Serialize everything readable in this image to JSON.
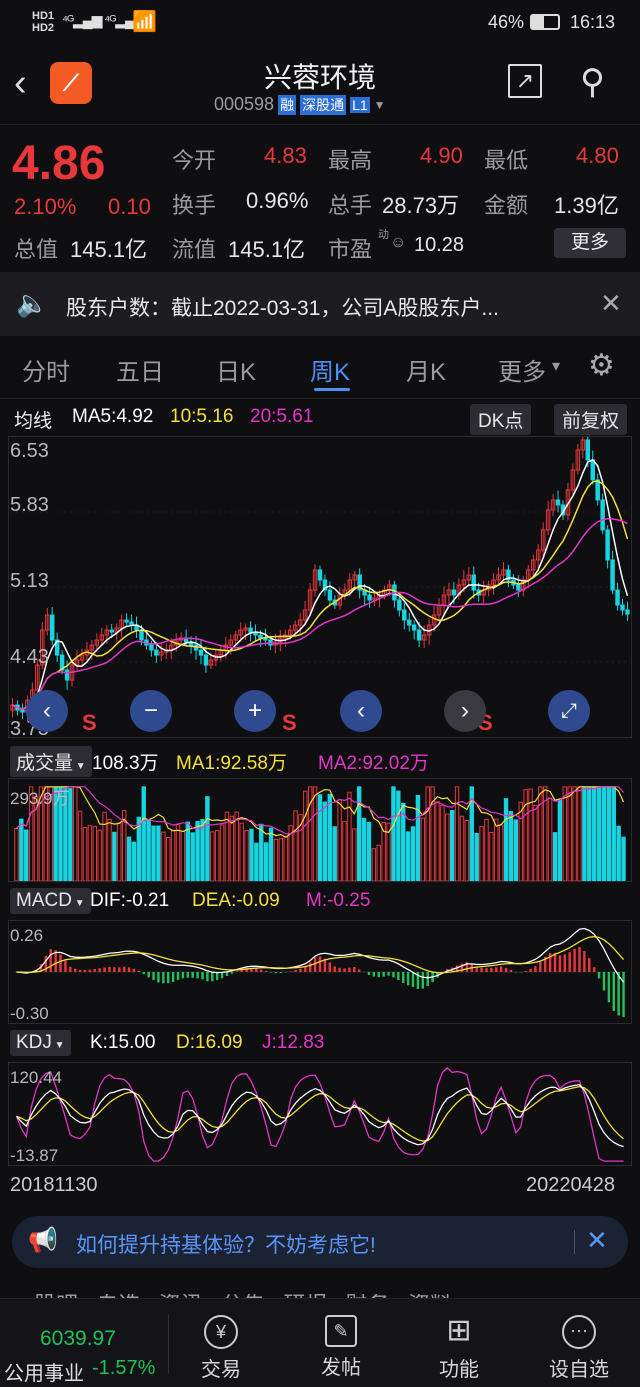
{
  "status": {
    "left_icons": "HD1 HD2 4G 4G wifi",
    "battery": "46%",
    "time": "16:13"
  },
  "header": {
    "title": "兴蓉环境",
    "code": "000598",
    "badge_margin": "融",
    "badge_connect": "深股通",
    "badge_level": "L1"
  },
  "quote": {
    "price": "4.86",
    "change_pct": "2.10%",
    "change_amt": "0.10",
    "open_label": "今开",
    "open": "4.83",
    "high_label": "最高",
    "high": "4.90",
    "low_label": "最低",
    "low": "4.80",
    "turnover_label": "换手",
    "turnover": "0.96%",
    "volume_label": "总手",
    "volume": "28.73万",
    "amount_label": "金额",
    "amount": "1.39亿",
    "mktcap_label": "总值",
    "mktcap": "145.1亿",
    "float_label": "流值",
    "float": "145.1亿",
    "pe_label": "市盈",
    "pe_sup": "动",
    "pe": "10.28",
    "more_button": "更多"
  },
  "notice": {
    "text": "股东户数：截止2022-03-31，公司A股股东户..."
  },
  "tabs": [
    {
      "label": "分时",
      "active": false
    },
    {
      "label": "五日",
      "active": false
    },
    {
      "label": "日K",
      "active": false
    },
    {
      "label": "周K",
      "active": true
    },
    {
      "label": "月K",
      "active": false
    },
    {
      "label": "更多",
      "active": false
    }
  ],
  "kline": {
    "ma_label": "均线",
    "ma5": "MA5:4.92",
    "ma10": "10:5.16",
    "ma20": "20:5.61",
    "dk_button": "DK点",
    "adjust_button": "前复权",
    "y_ticks": [
      "6.53",
      "5.83",
      "5.13",
      "4.43",
      "3.73"
    ],
    "s_marker": "S"
  },
  "volume": {
    "label": "成交量",
    "value": "108.3万",
    "ma1": "MA1:92.58万",
    "ma2": "MA2:92.02万",
    "top": "293.9万"
  },
  "macd": {
    "label": "MACD",
    "dif": "DIF:-0.21",
    "dea": "DEA:-0.09",
    "m": "M:-0.25",
    "top": "0.26",
    "bottom": "-0.30"
  },
  "kdj": {
    "label": "KDJ",
    "k": "K:15.00",
    "d": "D:16.09",
    "j": "J:12.83",
    "top": "120.44",
    "bottom": "-13.87"
  },
  "dates": {
    "start": "20181130",
    "end": "20220428"
  },
  "survey": {
    "text": "如何提升持基体验？不妨考虑它!"
  },
  "bottom": {
    "index_value": "6039.97",
    "index_name": "公用事业",
    "index_change": "-1.57%",
    "partial_tabs": "股吧   自选   资讯   公告   研报   财务   资料",
    "nav": [
      "交易",
      "发帖",
      "功能",
      "设自选"
    ]
  },
  "colors": {
    "up": "#e8383b",
    "down": "#17d4e0",
    "accent": "#4e8ef7",
    "ma5": "#ffffff",
    "ma10": "#f5e13a",
    "ma20": "#e536c9"
  },
  "chart_data": {
    "type": "candlestick",
    "period": "weekly",
    "x_range": [
      "20181130",
      "20220428"
    ],
    "y_ticks": [
      6.53,
      5.83,
      5.13,
      4.43,
      3.73
    ],
    "ylim": [
      3.73,
      6.53
    ],
    "close": [
      3.95,
      3.9,
      3.88,
      4.0,
      4.1,
      4.35,
      4.7,
      4.85,
      4.6,
      4.45,
      4.3,
      4.2,
      4.35,
      4.4,
      4.45,
      4.5,
      4.55,
      4.6,
      4.65,
      4.7,
      4.68,
      4.72,
      4.8,
      4.78,
      4.75,
      4.7,
      4.6,
      4.55,
      4.5,
      4.45,
      4.48,
      4.5,
      4.55,
      4.6,
      4.62,
      4.58,
      4.55,
      4.5,
      4.45,
      4.35,
      4.4,
      4.45,
      4.5,
      4.55,
      4.6,
      4.65,
      4.7,
      4.72,
      4.68,
      4.65,
      4.62,
      4.6,
      4.55,
      4.58,
      4.62,
      4.65,
      4.7,
      4.75,
      4.8,
      4.9,
      5.1,
      5.3,
      5.2,
      5.1,
      5.0,
      4.95,
      5.05,
      5.1,
      5.2,
      5.25,
      5.1,
      5.05,
      5.0,
      5.02,
      5.05,
      5.1,
      5.15,
      5.0,
      4.9,
      4.8,
      4.75,
      4.7,
      4.6,
      4.65,
      4.75,
      4.85,
      4.95,
      5.05,
      5.1,
      5.05,
      5.15,
      5.2,
      5.25,
      5.1,
      5.05,
      5.1,
      5.15,
      5.2,
      5.25,
      5.3,
      5.2,
      5.15,
      5.1,
      5.2,
      5.3,
      5.4,
      5.5,
      5.7,
      5.9,
      6.0,
      5.95,
      5.85,
      6.1,
      6.3,
      6.5,
      6.6,
      6.4,
      6.2,
      6.0,
      5.7,
      5.4,
      5.1,
      4.95,
      4.9,
      4.86
    ]
  }
}
